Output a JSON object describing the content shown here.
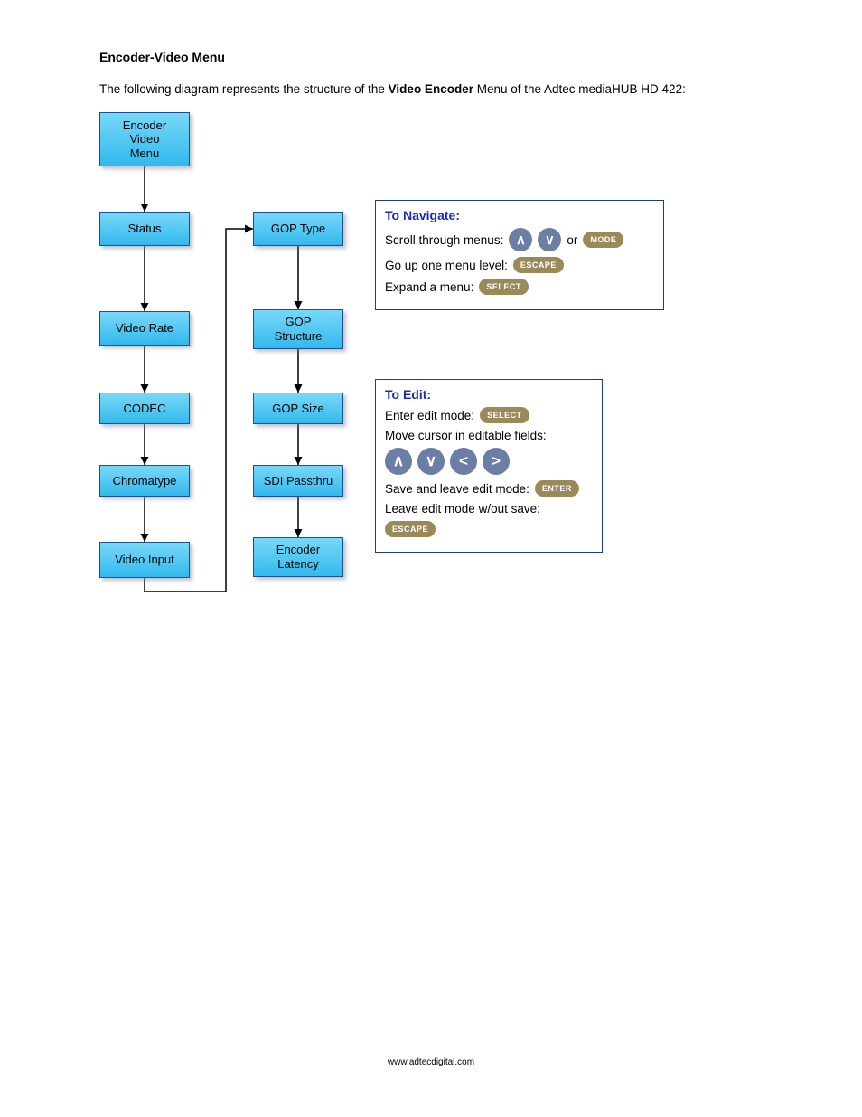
{
  "heading": "Encoder-Video Menu",
  "intro_pre": "The following diagram represents the structure of the  ",
  "intro_bold": "Video Encoder",
  "intro_post": " Menu of the Adtec mediaHUB HD 422:",
  "boxes": {
    "root": "Encoder\nVideo\nMenu",
    "col1": [
      "Status",
      "Video Rate",
      "CODEC",
      "Chromatype",
      "Video Input"
    ],
    "col2": [
      "GOP Type",
      "GOP\nStructure",
      "GOP Size",
      "SDI Passthru",
      "Encoder\nLatency"
    ]
  },
  "panel_nav": {
    "title": "To Navigate:",
    "line1_pre": "Scroll through menus:",
    "line1_or": "or",
    "line1_mode": "MODE",
    "line2_pre": "Go up one menu level:",
    "line2_btn": "ESCAPE",
    "line3_pre": "Expand a menu:",
    "line3_btn": "SELECT"
  },
  "panel_edit": {
    "title": "To Edit:",
    "line1_pre": "Enter edit mode:",
    "line1_btn": "SELECT",
    "line2_pre": "Move cursor in editable fields:",
    "line3_pre": "Save and leave edit mode:",
    "line3_btn": "ENTER",
    "line4_pre": "Leave edit mode w/out save:",
    "line4_btn": "ESCAPE"
  },
  "footer": "www.adtecdigital.com",
  "chart_data": {
    "type": "flowchart",
    "nodes": [
      {
        "id": "root",
        "label": "Encoder Video Menu"
      },
      {
        "id": "status",
        "label": "Status"
      },
      {
        "id": "videorate",
        "label": "Video Rate"
      },
      {
        "id": "codec",
        "label": "CODEC"
      },
      {
        "id": "chroma",
        "label": "Chromatype"
      },
      {
        "id": "videoinput",
        "label": "Video Input"
      },
      {
        "id": "goptype",
        "label": "GOP Type"
      },
      {
        "id": "gopstruct",
        "label": "GOP Structure"
      },
      {
        "id": "gopsize",
        "label": "GOP Size"
      },
      {
        "id": "sdipass",
        "label": "SDI Passthru"
      },
      {
        "id": "enclat",
        "label": "Encoder Latency"
      }
    ],
    "edges": [
      [
        "root",
        "status"
      ],
      [
        "status",
        "videorate"
      ],
      [
        "videorate",
        "codec"
      ],
      [
        "codec",
        "chroma"
      ],
      [
        "chroma",
        "videoinput"
      ],
      [
        "videoinput",
        "goptype"
      ],
      [
        "goptype",
        "gopstruct"
      ],
      [
        "gopstruct",
        "gopsize"
      ],
      [
        "gopsize",
        "sdipass"
      ],
      [
        "sdipass",
        "enclat"
      ]
    ],
    "layout_columns": [
      [
        "root",
        "status",
        "videorate",
        "codec",
        "chroma",
        "videoinput"
      ],
      [
        "goptype",
        "gopstruct",
        "gopsize",
        "sdipass",
        "enclat"
      ]
    ]
  }
}
